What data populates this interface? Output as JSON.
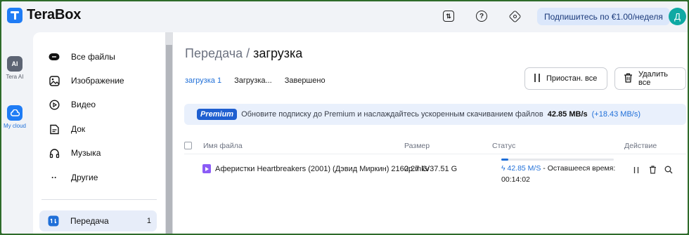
{
  "app": {
    "name": "TeraBox"
  },
  "header": {
    "subscribe_label": "Подпишитесь по €1.00/неделя",
    "avatar_letter": "Д"
  },
  "rail": [
    {
      "label": "Tera AI",
      "icon": "ai-icon",
      "icon_text": "AI",
      "color": "#5d6473"
    },
    {
      "label": "My cloud",
      "icon": "cloud-icon",
      "color": "#1f7cf5"
    }
  ],
  "sidebar": {
    "items": [
      {
        "label": "Все файлы",
        "icon": "all-files-icon"
      },
      {
        "label": "Изображение",
        "icon": "image-icon"
      },
      {
        "label": "Видео",
        "icon": "video-icon"
      },
      {
        "label": "Док",
        "icon": "document-icon"
      },
      {
        "label": "Музыка",
        "icon": "headphones-icon"
      },
      {
        "label": "Другие",
        "icon": "more-icon",
        "icon_text": "··"
      }
    ],
    "transfer": {
      "label": "Передача",
      "count": "1",
      "icon": "transfer-icon"
    }
  },
  "main": {
    "title_prefix": "Передача",
    "title_sep": " / ",
    "title_current": "загрузка",
    "tabs": [
      {
        "label": "загрузка 1",
        "active": true
      },
      {
        "label": "Загрузка...",
        "active": false
      },
      {
        "label": "Завершено",
        "active": false
      }
    ],
    "pause_all_label": "Приостан. все",
    "delete_all_label": "Удалить все",
    "banner": {
      "badge": "Premium",
      "text": "Обновите подписку до Premium и наслаждайтесь ускоренным скачиванием файлов",
      "speed": "42.85 MB/s",
      "extra": "(+18.43 MB/s)"
    },
    "table": {
      "headers": {
        "name": "Имя файла",
        "size": "Размер",
        "status": "Статус",
        "action": "Действие"
      },
      "rows": [
        {
          "name": "Аферистки Heartbreakers (2001) (Дэвид Миркин) 2160p.mkv",
          "size": "2.27 G/37.51 G",
          "progress": 0.06,
          "speed": "42.85 M/S",
          "remaining_label": " - Оставшееся время:",
          "remaining": "00:14:02"
        }
      ]
    }
  },
  "colors": {
    "accent": "#1f6fd8",
    "brand": "#1f7cf5",
    "avatar": "#0fa9a3"
  }
}
